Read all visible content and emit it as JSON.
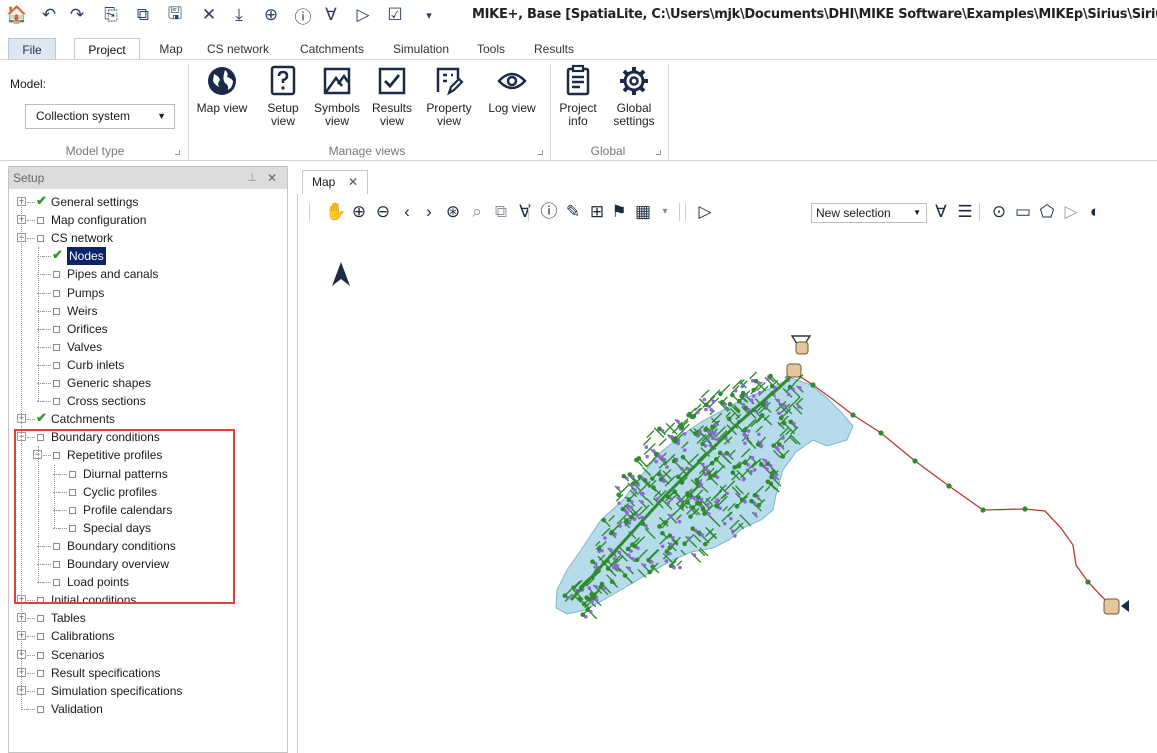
{
  "window": {
    "title": "MIKE+, Base [SpatiaLite, C:\\Users\\mjk\\Documents\\DHI\\MIKE Software\\Examples\\MIKEp\\Sirius\\Sirius.sqlit"
  },
  "quick_access": {
    "icons": [
      "app-icon",
      "undo-icon",
      "redo-icon",
      "new-icon",
      "open-icon",
      "save-icon",
      "close-icon",
      "import-icon",
      "globe-icon",
      "info-icon",
      "filter-clear-icon",
      "selection-clear-icon",
      "checkbox-icon",
      "customize-icon"
    ],
    "glyphs": [
      "🏠",
      "↶",
      "↷",
      "⎘",
      "⧉",
      "🖫",
      "✕",
      "⤓",
      "⊕",
      "ⓘ",
      "∀",
      "▷",
      "☑",
      "▾"
    ]
  },
  "ribbon_tabs": [
    "File",
    "Project",
    "Map",
    "CS network",
    "Catchments",
    "Simulation",
    "Tools",
    "Results"
  ],
  "ribbon": {
    "model_label": "Model:",
    "model_value": "Collection system",
    "groups": {
      "model_type": "Model type",
      "manage_views": "Manage views",
      "global": "Global"
    },
    "buttons": [
      {
        "line1": "Map view",
        "line2": ""
      },
      {
        "line1": "Setup",
        "line2": "view"
      },
      {
        "line1": "Symbols",
        "line2": "view"
      },
      {
        "line1": "Results",
        "line2": "view"
      },
      {
        "line1": "Property",
        "line2": "view"
      },
      {
        "line1": "Log view",
        "line2": ""
      },
      {
        "line1": "Project",
        "line2": "info"
      },
      {
        "line1": "Global",
        "line2": "settings"
      }
    ]
  },
  "setup_panel": {
    "title": "Setup",
    "pin_glyph": "⊥",
    "close_glyph": "✕",
    "tree": [
      {
        "label": "General settings",
        "expander": "+",
        "checked": true,
        "level": 0
      },
      {
        "label": "Map configuration",
        "expander": "+",
        "checked": false,
        "level": 0
      },
      {
        "label": "CS network",
        "expander": "-",
        "checked": false,
        "level": 0
      },
      {
        "label": "Nodes",
        "expander": "",
        "checked": true,
        "level": 1,
        "selected": true
      },
      {
        "label": "Pipes and canals",
        "expander": "",
        "checked": false,
        "level": 1
      },
      {
        "label": "Pumps",
        "expander": "",
        "checked": false,
        "level": 1
      },
      {
        "label": "Weirs",
        "expander": "",
        "checked": false,
        "level": 1
      },
      {
        "label": "Orifices",
        "expander": "",
        "checked": false,
        "level": 1
      },
      {
        "label": "Valves",
        "expander": "",
        "checked": false,
        "level": 1
      },
      {
        "label": "Curb inlets",
        "expander": "",
        "checked": false,
        "level": 1
      },
      {
        "label": "Generic shapes",
        "expander": "",
        "checked": false,
        "level": 1
      },
      {
        "label": "Cross sections",
        "expander": "",
        "checked": false,
        "level": 1
      },
      {
        "label": "Catchments",
        "expander": "+",
        "checked": true,
        "level": 0
      },
      {
        "label": "Boundary conditions",
        "expander": "-",
        "checked": false,
        "level": 0
      },
      {
        "label": "Repetitive profiles",
        "expander": "-",
        "checked": false,
        "level": 1
      },
      {
        "label": "Diurnal patterns",
        "expander": "",
        "checked": false,
        "level": 2
      },
      {
        "label": "Cyclic profiles",
        "expander": "",
        "checked": false,
        "level": 2
      },
      {
        "label": "Profile calendars",
        "expander": "",
        "checked": false,
        "level": 2
      },
      {
        "label": "Special days",
        "expander": "",
        "checked": false,
        "level": 2
      },
      {
        "label": "Boundary conditions",
        "expander": "",
        "checked": false,
        "level": 1
      },
      {
        "label": "Boundary overview",
        "expander": "",
        "checked": false,
        "level": 1
      },
      {
        "label": "Load points",
        "expander": "",
        "checked": false,
        "level": 1
      },
      {
        "label": "Initial conditions",
        "expander": "+",
        "checked": false,
        "level": 0
      },
      {
        "label": "Tables",
        "expander": "+",
        "checked": false,
        "level": 0
      },
      {
        "label": "Calibrations",
        "expander": "+",
        "checked": false,
        "level": 0
      },
      {
        "label": "Scenarios",
        "expander": "+",
        "checked": false,
        "level": 0
      },
      {
        "label": "Result specifications",
        "expander": "+",
        "checked": false,
        "level": 0
      },
      {
        "label": "Simulation specifications",
        "expander": "+",
        "checked": false,
        "level": 0
      },
      {
        "label": "Validation",
        "expander": "",
        "checked": false,
        "level": 0
      }
    ]
  },
  "map_tab": {
    "label": "Map",
    "close_glyph": "✕"
  },
  "map_toolbar": {
    "selection_mode": "New selection",
    "tools": [
      "pan-hand-icon",
      "zoom-in-icon",
      "zoom-out-icon",
      "previous-extent-icon",
      "next-extent-icon",
      "full-extent-icon",
      "zoom-layer-icon",
      "pan-layer-icon",
      "clear-filter-icon",
      "identify-icon",
      "edit-attributes-icon",
      "network-icon",
      "flag-icon",
      "chart-icon",
      "dropdown-icon"
    ],
    "glyphs": [
      "✋",
      "⊕",
      "⊖",
      "‹",
      "›",
      "⊛",
      "⌕",
      "⧉",
      "∀",
      "ⓘ",
      "✎",
      "⊞",
      "⚑",
      "▦",
      "▾"
    ],
    "select_tools": [
      "select-arrow-icon",
      "filter-select-icon",
      "list-icon",
      "mouse-icon",
      "rectangle-select-icon",
      "polygon-select-icon",
      "deselect-icon",
      "contrast-icon"
    ],
    "select_glyphs": [
      "▷",
      "∀",
      "☰",
      "⊙",
      "▭",
      "⬠",
      "▷",
      "◐"
    ]
  },
  "colors": {
    "pipe_network": "#2e8b2e",
    "catchment_fill": "#b6dcec",
    "node_points": "#9b5ee6",
    "outfall_line": "#c0392b",
    "selection_highlight": "#0a246a",
    "callout_box": "#e0403a"
  }
}
